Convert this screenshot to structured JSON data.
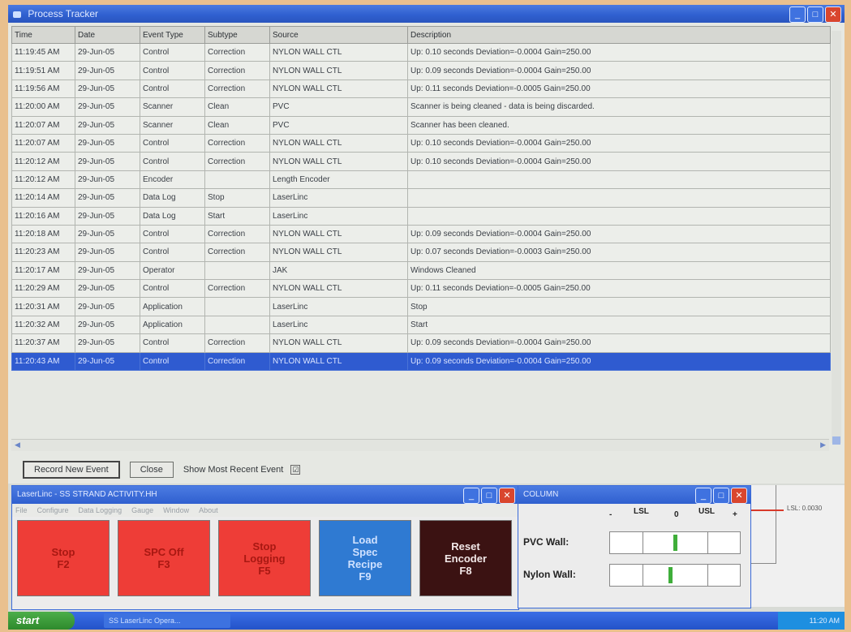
{
  "window": {
    "title": "Process Tracker"
  },
  "grid": {
    "columns": [
      "Time",
      "Date",
      "Event Type",
      "Subtype",
      "Source",
      "Description"
    ],
    "rows": [
      [
        "11:19:45 AM",
        "29-Jun-05",
        "Control",
        "Correction",
        "NYLON WALL CTL",
        "Up: 0.10 seconds  Deviation=-0.0004  Gain=250.00"
      ],
      [
        "11:19:51 AM",
        "29-Jun-05",
        "Control",
        "Correction",
        "NYLON WALL CTL",
        "Up: 0.09 seconds  Deviation=-0.0004  Gain=250.00"
      ],
      [
        "11:19:56 AM",
        "29-Jun-05",
        "Control",
        "Correction",
        "NYLON WALL CTL",
        "Up: 0.11 seconds  Deviation=-0.0005  Gain=250.00"
      ],
      [
        "11:20:00 AM",
        "29-Jun-05",
        "Scanner",
        "Clean",
        "PVC",
        "Scanner is being cleaned - data is being discarded."
      ],
      [
        "11:20:07 AM",
        "29-Jun-05",
        "Scanner",
        "Clean",
        "PVC",
        "Scanner has been cleaned."
      ],
      [
        "11:20:07 AM",
        "29-Jun-05",
        "Control",
        "Correction",
        "NYLON WALL CTL",
        "Up: 0.10 seconds  Deviation=-0.0004  Gain=250.00"
      ],
      [
        "11:20:12 AM",
        "29-Jun-05",
        "Control",
        "Correction",
        "NYLON WALL CTL",
        "Up: 0.10 seconds  Deviation=-0.0004  Gain=250.00"
      ],
      [
        "11:20:12 AM",
        "29-Jun-05",
        "Encoder",
        "",
        "Length Encoder",
        ""
      ],
      [
        "11:20:14 AM",
        "29-Jun-05",
        "Data Log",
        "Stop",
        "LaserLinc",
        ""
      ],
      [
        "11:20:16 AM",
        "29-Jun-05",
        "Data Log",
        "Start",
        "LaserLinc",
        ""
      ],
      [
        "11:20:18 AM",
        "29-Jun-05",
        "Control",
        "Correction",
        "NYLON WALL CTL",
        "Up: 0.09 seconds  Deviation=-0.0004  Gain=250.00"
      ],
      [
        "11:20:23 AM",
        "29-Jun-05",
        "Control",
        "Correction",
        "NYLON WALL CTL",
        "Up: 0.07 seconds  Deviation=-0.0003  Gain=250.00"
      ],
      [
        "11:20:17 AM",
        "29-Jun-05",
        "Operator",
        "",
        "JAK",
        "Windows Cleaned"
      ],
      [
        "11:20:29 AM",
        "29-Jun-05",
        "Control",
        "Correction",
        "NYLON WALL CTL",
        "Up: 0.11 seconds  Deviation=-0.0005  Gain=250.00"
      ],
      [
        "11:20:31 AM",
        "29-Jun-05",
        "Application",
        "",
        "LaserLinc",
        "Stop"
      ],
      [
        "11:20:32 AM",
        "29-Jun-05",
        "Application",
        "",
        "LaserLinc",
        "Start"
      ],
      [
        "11:20:37 AM",
        "29-Jun-05",
        "Control",
        "Correction",
        "NYLON WALL CTL",
        "Up: 0.09 seconds  Deviation=-0.0004  Gain=250.00"
      ],
      [
        "11:20:43 AM",
        "29-Jun-05",
        "Control",
        "Correction",
        "NYLON WALL CTL",
        "Up: 0.09 seconds  Deviation=-0.0004  Gain=250.00"
      ]
    ],
    "selected_row": 17
  },
  "buttons": {
    "record": "Record New Event",
    "close": "Close",
    "show_recent": "Show Most Recent Event",
    "show_recent_checked": "☑"
  },
  "laserlinc": {
    "title": "LaserLinc - SS STRAND ACTIVITY.HH",
    "menu": [
      "File",
      "Configure",
      "Data Logging",
      "Gauge",
      "Window",
      "About"
    ],
    "fkeys": [
      {
        "label": "Stop\nF2",
        "color": "red"
      },
      {
        "label": "SPC Off\nF3",
        "color": "red"
      },
      {
        "label": "Stop\nLogging\nF5",
        "color": "red"
      },
      {
        "label": "Load\nSpec\nRecipe\nF9",
        "color": "blue"
      },
      {
        "label": "Reset\nEncoder\nF8",
        "color": "dark"
      }
    ]
  },
  "column": {
    "title": "COLUMN",
    "minus": "-",
    "lsl": "LSL",
    "zero": "0",
    "usl": "USL",
    "plus": "+",
    "rows": [
      {
        "label": "PVC Wall:",
        "level": 0.5
      },
      {
        "label": "Nylon Wall:",
        "level": 0.46
      }
    ]
  },
  "background_panel": {
    "lsl_text": "LSL: 0.0030"
  },
  "taskbar": {
    "start": "start",
    "task": "SS LaserLinc Opera...",
    "clock": "11:20 AM"
  }
}
